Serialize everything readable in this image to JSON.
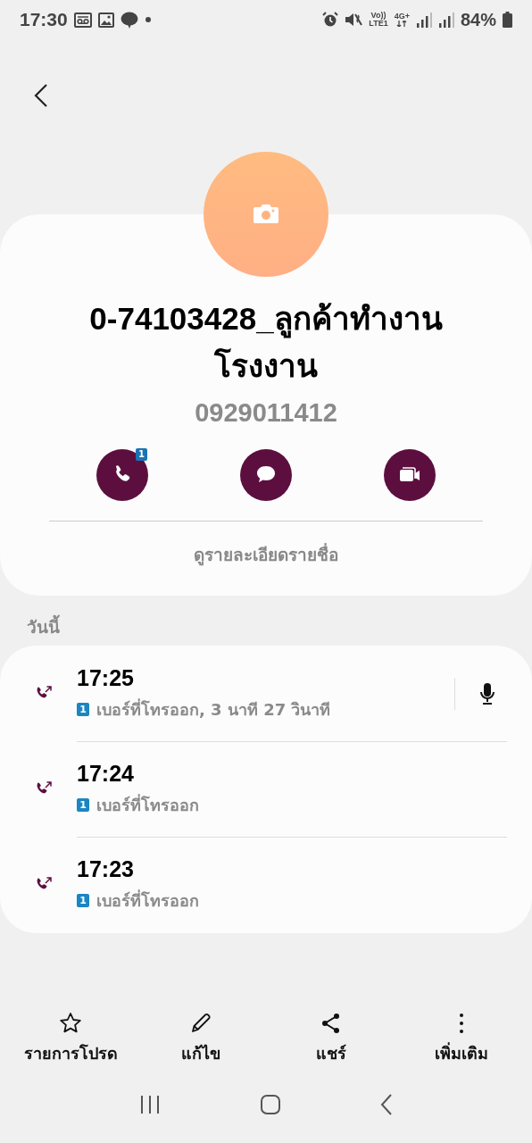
{
  "status_bar": {
    "time": "17:30",
    "volte": "Vo))",
    "lte": "LTE1",
    "network": "4G+",
    "battery": "84%"
  },
  "contact": {
    "name": "0-74103428_ลูกค้าทำงานโรงงาน",
    "number": "0929011412"
  },
  "actions": [
    {
      "kind": "call",
      "badge": "1"
    },
    {
      "kind": "message"
    },
    {
      "kind": "video"
    }
  ],
  "details_link": "ดูรายละเอียดรายชื่อ",
  "section_title": "วันนี้",
  "call_log": [
    {
      "time": "17:25",
      "sim": "1",
      "description": "เบอร์ที่โทรออก, 3 นาที 27 วินาที",
      "recording": true
    },
    {
      "time": "17:24",
      "sim": "1",
      "description": "เบอร์ที่โทรออก",
      "recording": false
    },
    {
      "time": "17:23",
      "sim": "1",
      "description": "เบอร์ที่โทรออก",
      "recording": false
    }
  ],
  "bottom_actions": [
    {
      "kind": "favorite",
      "label": "รายการโปรด"
    },
    {
      "kind": "edit",
      "label": "แก้ไข"
    },
    {
      "kind": "share",
      "label": "แชร์"
    },
    {
      "kind": "more",
      "label": "เพิ่มเติม"
    }
  ]
}
